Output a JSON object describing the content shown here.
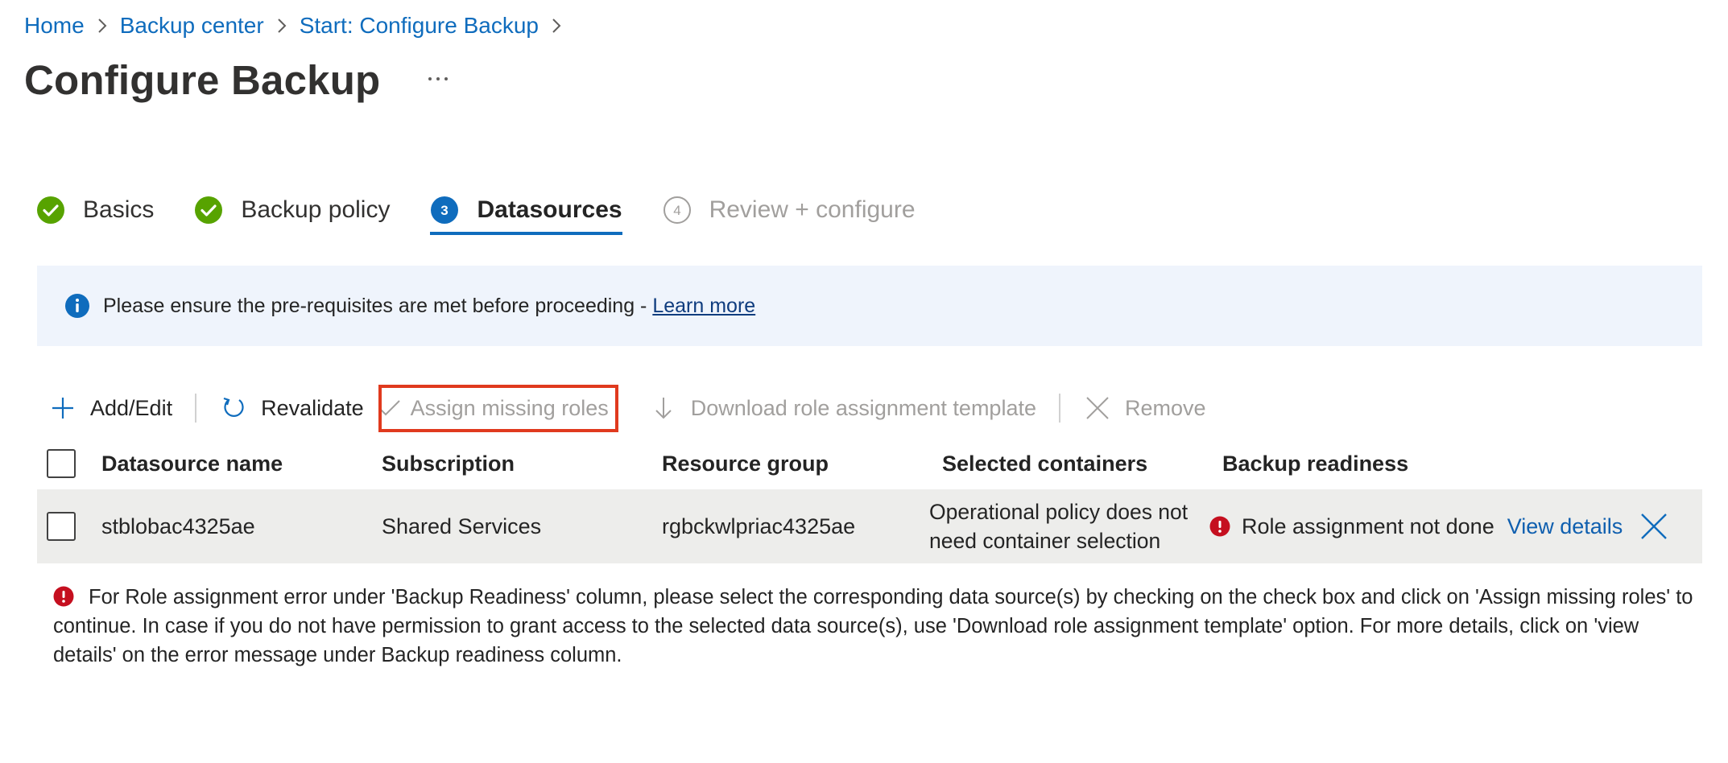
{
  "breadcrumb": {
    "items": [
      "Home",
      "Backup center",
      "Start: Configure Backup"
    ]
  },
  "page": {
    "title": "Configure Backup",
    "more_label": "···"
  },
  "tabs": [
    {
      "label": "Basics",
      "state": "done",
      "icon": "check-circle-icon"
    },
    {
      "label": "Backup policy",
      "state": "done",
      "icon": "check-circle-icon"
    },
    {
      "label": "Datasources",
      "state": "active",
      "step": "3"
    },
    {
      "label": "Review + configure",
      "state": "pending",
      "step": "4"
    }
  ],
  "info_banner": {
    "text": "Please ensure the pre-requisites are met before proceeding - ",
    "link": "Learn more",
    "icon": "info-icon"
  },
  "toolbar": {
    "add_edit": "Add/Edit",
    "revalidate": "Revalidate",
    "assign_missing_roles": "Assign missing roles",
    "download_template": "Download role assignment template",
    "remove": "Remove"
  },
  "grid": {
    "columns": [
      "Datasource name",
      "Subscription",
      "Resource group",
      "Selected containers",
      "Backup readiness"
    ],
    "rows": [
      {
        "name": "stblobac4325ae",
        "subscription": "Shared Services",
        "resource_group": "rgbckwlpriac4325ae",
        "containers_line1": "Operational policy does not",
        "containers_line2": "need container selection",
        "readiness": "Role assignment not done",
        "view_details": "View details"
      }
    ]
  },
  "note": {
    "text": "For Role assignment error under 'Backup Readiness' column, please select the corresponding data source(s) by checking on the check box and click on 'Assign missing roles' to continue. In case if you do not have permission to grant access to the selected data source(s), use 'Download role assignment template' option. For more details, click on 'view details' on the error message under Backup readiness column."
  },
  "colors": {
    "accent": "#0f6cbd",
    "success": "#57a300",
    "error": "#c50f1f",
    "highlight": "#e03a1e",
    "banner_bg": "#eff4fc",
    "row_bg": "#ededeb"
  }
}
